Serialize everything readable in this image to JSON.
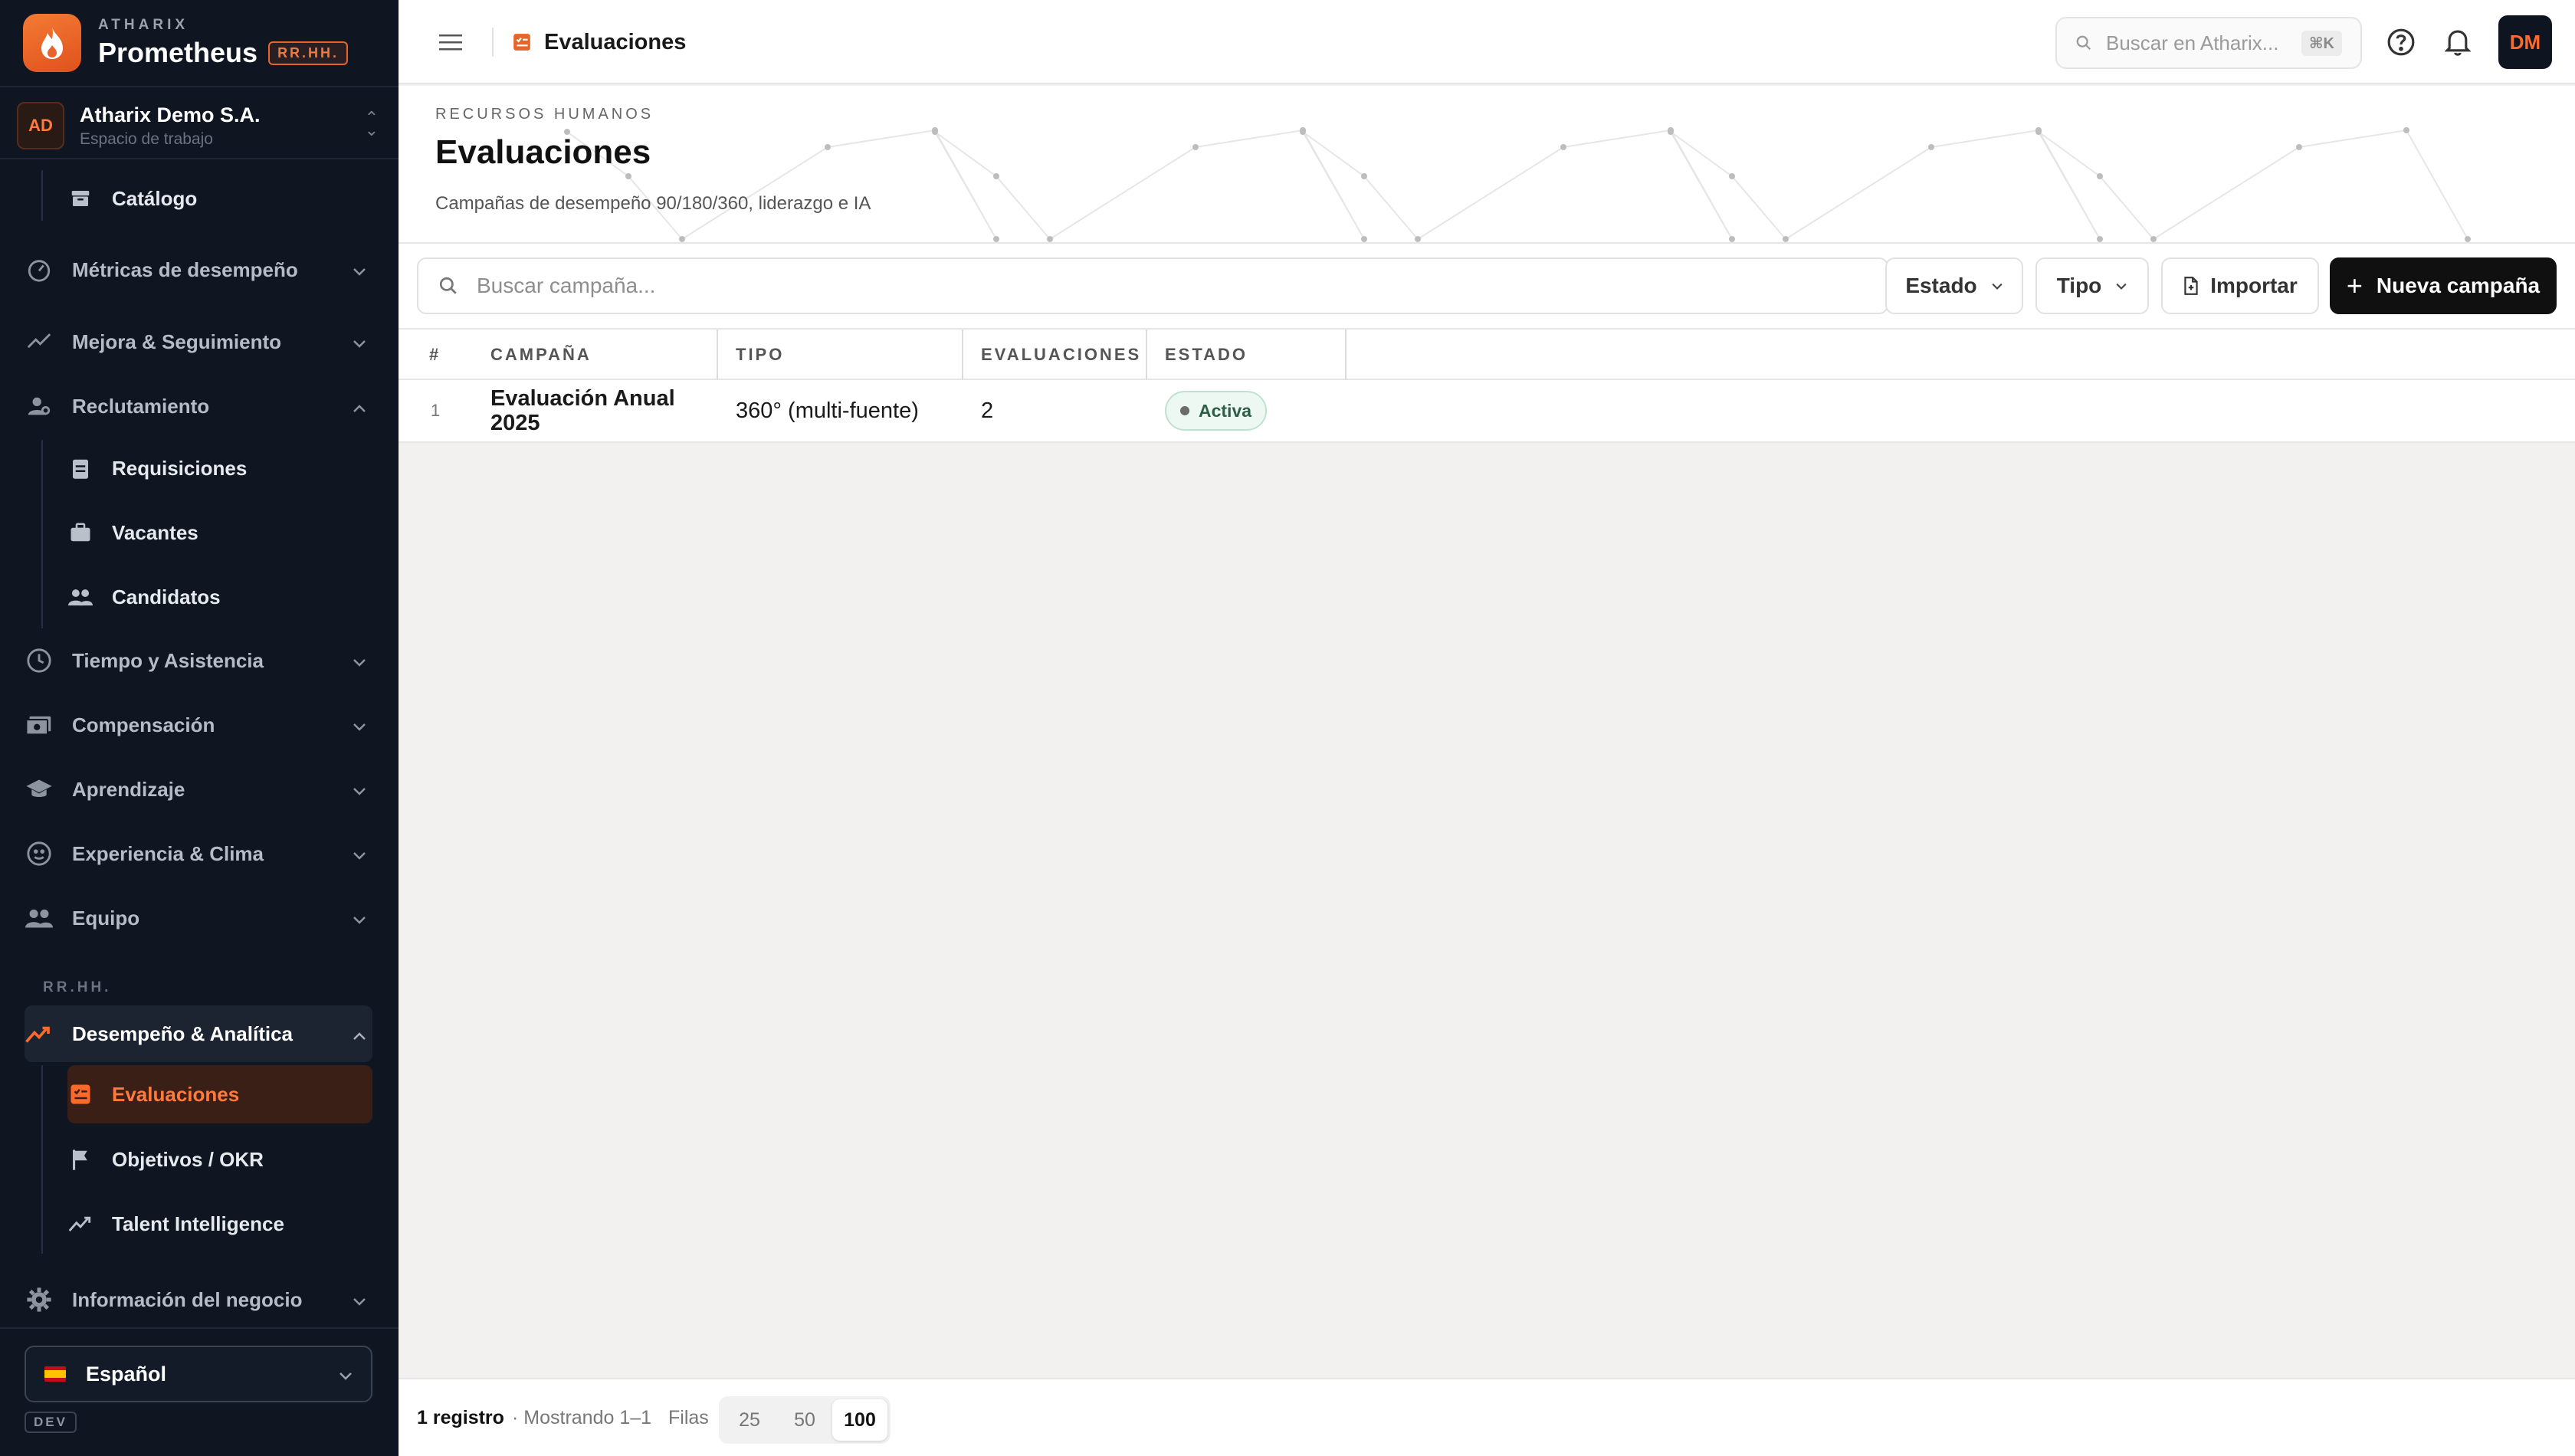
{
  "brand": {
    "small": "ATHARIX",
    "name": "Prometheus",
    "badge": "RR.HH."
  },
  "workspace": {
    "initials": "AD",
    "name": "Atharix Demo S.A.",
    "sub": "Espacio de trabajo"
  },
  "sidebar": {
    "catalog": "Catálogo",
    "groups": [
      {
        "label": "Métricas de desempeño",
        "icon": "gauge-icon"
      },
      {
        "label": "Mejora & Seguimiento",
        "icon": "trend-icon"
      },
      {
        "label": "Reclutamiento",
        "icon": "person-search-icon"
      },
      {
        "label": "Tiempo y Asistencia",
        "icon": "clock-icon"
      },
      {
        "label": "Compensación",
        "icon": "money-icon"
      },
      {
        "label": "Aprendizaje",
        "icon": "graduation-cap-icon"
      },
      {
        "label": "Experiencia & Clima",
        "icon": "smiley-icon"
      },
      {
        "label": "Equipo",
        "icon": "people-icon"
      },
      {
        "label": "Desempeño & Analítica",
        "icon": "trend-up-icon"
      },
      {
        "label": "Información del negocio",
        "icon": "gear-icon"
      }
    ],
    "recruit_items": [
      "Requisiciones",
      "Vacantes",
      "Candidatos"
    ],
    "section_label": "RR.HH.",
    "perf_items": [
      "Evaluaciones",
      "Objetivos / OKR",
      "Talent Intelligence"
    ],
    "language": "Español",
    "env": "DEV"
  },
  "topbar": {
    "breadcrumb": "Evaluaciones",
    "search_placeholder": "Buscar en Atharix...",
    "shortcut": "⌘K",
    "avatar": "DM"
  },
  "header": {
    "eyebrow": "RECURSOS HUMANOS",
    "title": "Evaluaciones",
    "subtitle": "Campañas de desempeño 90/180/360, liderazgo e IA"
  },
  "toolbar": {
    "search_placeholder": "Buscar campaña...",
    "filter_estado": "Estado",
    "filter_tipo": "Tipo",
    "import": "Importar",
    "new": "Nueva campaña"
  },
  "table": {
    "columns": [
      "#",
      "CAMPAÑA",
      "TIPO",
      "EVALUACIONES",
      "ESTADO"
    ],
    "rows": [
      {
        "num": "1",
        "campaign": "Evaluación Anual 2025",
        "type": "360° (multi-fuente)",
        "evaluations": "2",
        "status": "Activa"
      }
    ]
  },
  "footer": {
    "count": "1 registro",
    "showing": "· Mostrando 1–1",
    "rows_label": "Filas",
    "page_sizes": [
      "25",
      "50",
      "100"
    ],
    "selected_page_size": "100"
  },
  "colors": {
    "accent": "#e8642a",
    "sidebar_bg": "#0f1622",
    "primary_btn": "#101010"
  }
}
